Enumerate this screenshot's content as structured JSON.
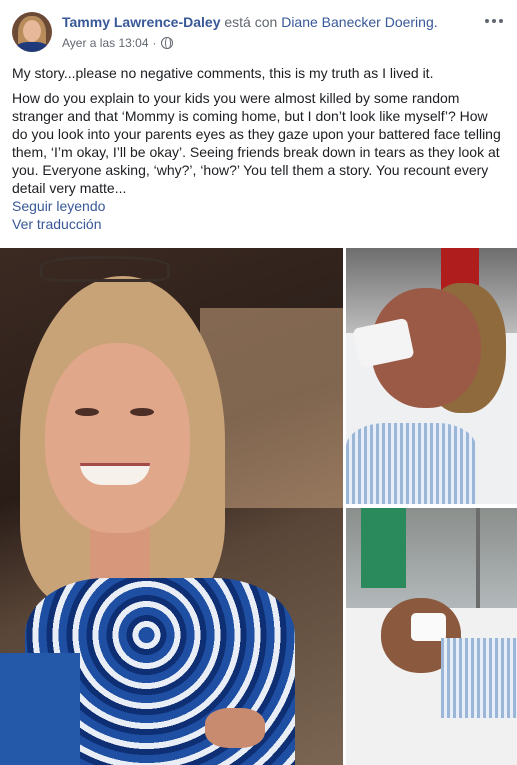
{
  "post": {
    "author": "Tammy Lawrence-Daley",
    "with_text": "está con",
    "tagged": "Diane Banecker Doering.",
    "timestamp": "Ayer a las 13:04",
    "separator": "·",
    "privacy_icon": "globe-icon",
    "more_icon": "more-options-icon",
    "paragraphs": [
      "My story...please no negative comments, this is my truth as I lived it.",
      "How do you explain to your kids you were almost killed by some random stranger and that ‘Mommy is coming home, but I don’t look like myself’? How do you look into your parents eyes as they gaze upon your battered face telling them, ‘I’m okay, I’ll be okay’. Seeing friends break down in tears as they look at you. Everyone asking, ‘why?’, ‘how?’ You tell them a story. You recount every detail very matte..."
    ],
    "see_more": "Seguir leyendo",
    "see_translation": "Ver traducción"
  },
  "colors": {
    "link": "#385898",
    "text": "#1c1e21",
    "meta": "#616770"
  }
}
